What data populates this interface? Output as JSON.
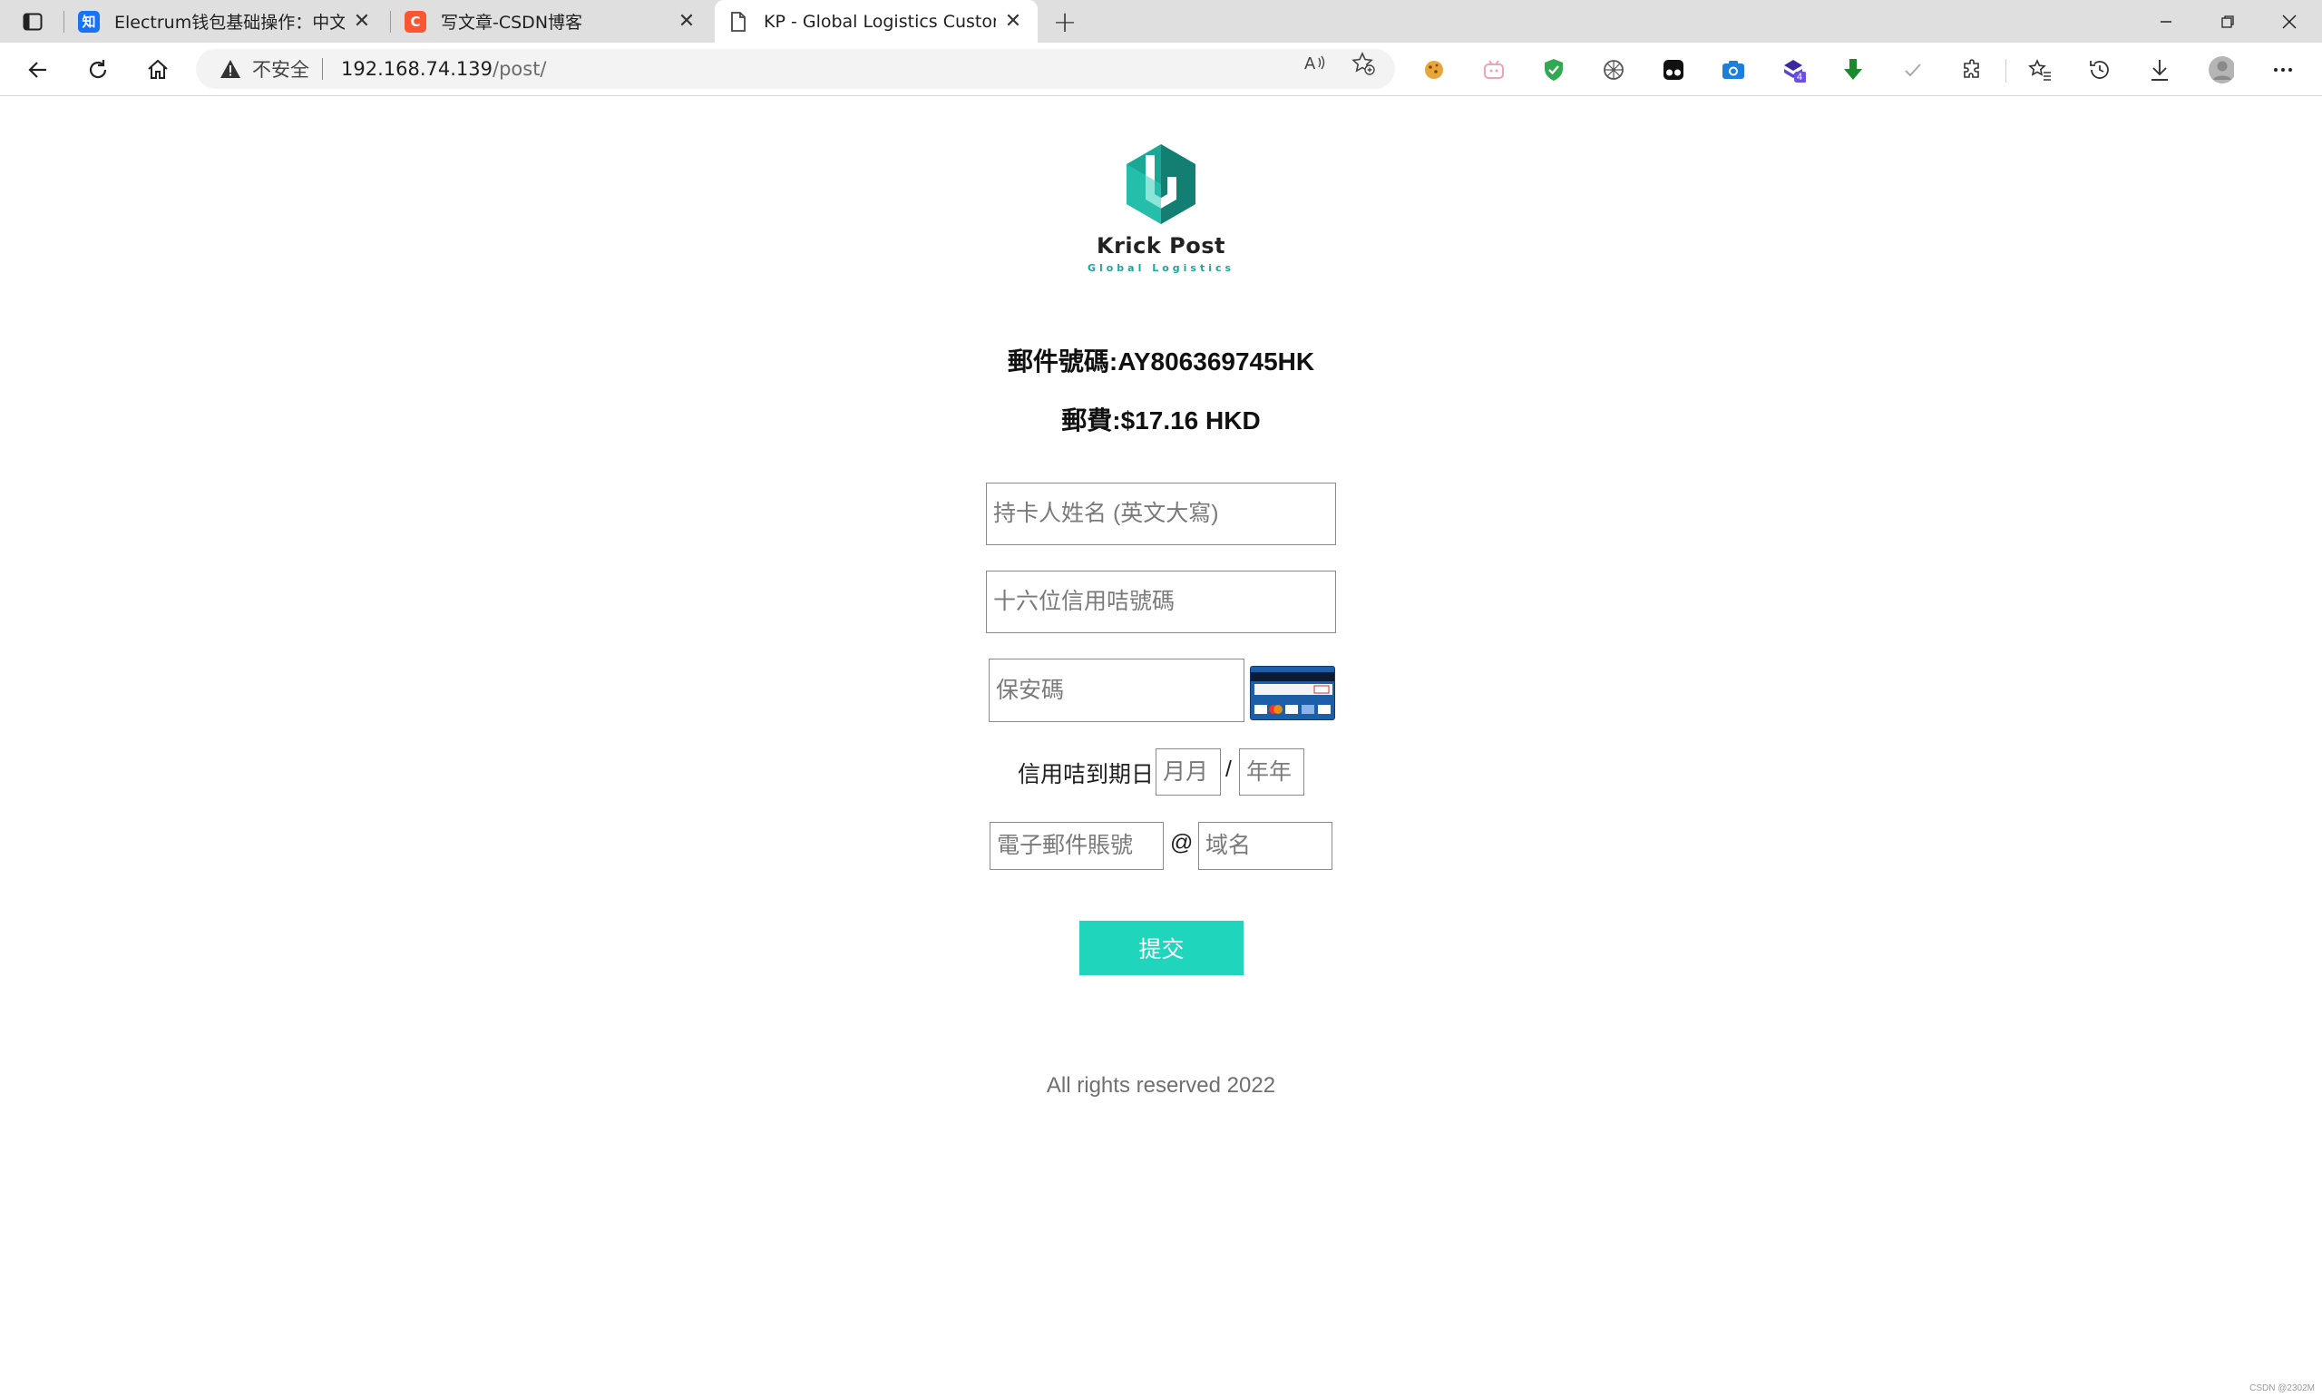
{
  "browser": {
    "tabs": [
      {
        "title": "Electrum钱包基础操作：中文界面",
        "favicon_text": "知",
        "favicon_color": "#1772f6"
      },
      {
        "title": "写文章-CSDN博客",
        "favicon_text": "C",
        "favicon_color": "#fc5531"
      },
      {
        "title": "KP - Global Logistics Customer c",
        "favicon_text": "",
        "favicon_color": "#ffffff"
      }
    ],
    "address": {
      "security_label": "不安全",
      "url_host": "192.168.74.139",
      "url_path": "/post/"
    },
    "extension_badge": "4"
  },
  "page": {
    "logo": {
      "name": "Krick Post",
      "tagline": "Global Logistics",
      "colors": {
        "dark": "#14a18f",
        "light": "#2fd0bb"
      }
    },
    "tracking_label": "郵件號碼:AY806369745HK",
    "fee_label": "郵費:$17.16 HKD",
    "form": {
      "cardholder_placeholder": "持卡人姓名 (英文大寫)",
      "card_number_placeholder": "十六位信用咭號碼",
      "cvv_placeholder": "保安碼",
      "expiry_label": "信用咭到期日",
      "month_placeholder": "月月",
      "expiry_separator": "/",
      "year_placeholder": "年年",
      "email_account_placeholder": "電子郵件賬號",
      "email_at": "@",
      "email_domain_placeholder": "域名",
      "submit_label": "提交"
    },
    "footer": "All rights reserved 2022",
    "watermark": "CSDN @2302M"
  },
  "colors": {
    "accent": "#1fd6bd",
    "tabbar_bg": "#dfdfdf"
  }
}
